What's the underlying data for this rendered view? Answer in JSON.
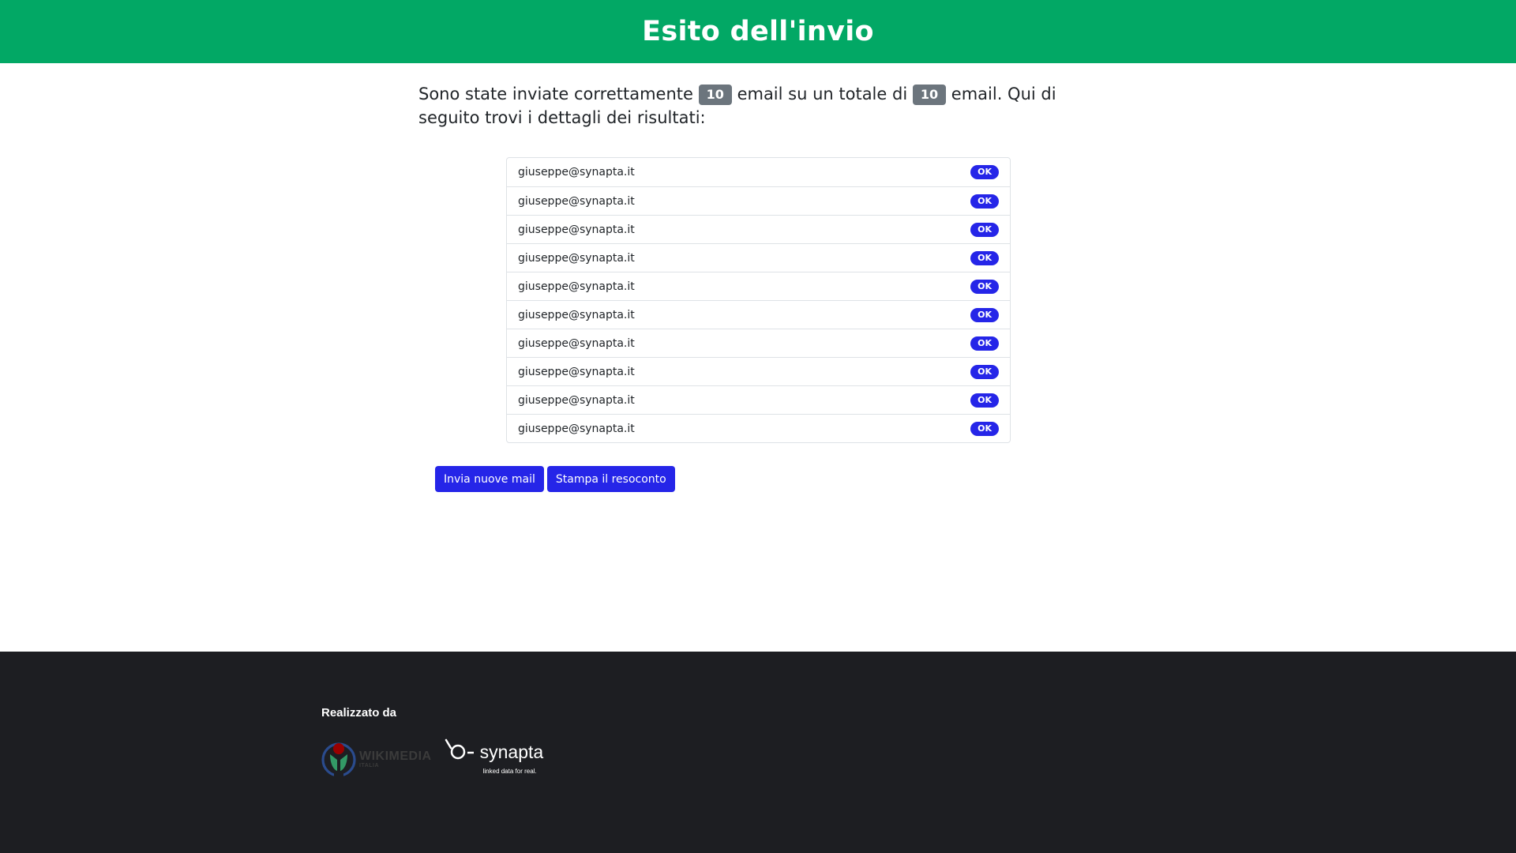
{
  "colors": {
    "header_bg": "#02a865",
    "footer_bg": "#1d1e22",
    "primary_button": "#2525e8",
    "ok_badge": "#2525e8",
    "count_badge": "#6c757d"
  },
  "header": {
    "title": "Esito dell'invio"
  },
  "summary": {
    "text_before": "Sono state inviate correttamente",
    "sent_count": "10",
    "text_middle": "email su un totale di",
    "total_count": "10",
    "text_after": "email. Qui di seguito trovi i dettagli dei risultati:"
  },
  "results": [
    {
      "email": "giuseppe@synapta.it",
      "status": "OK"
    },
    {
      "email": "giuseppe@synapta.it",
      "status": "OK"
    },
    {
      "email": "giuseppe@synapta.it",
      "status": "OK"
    },
    {
      "email": "giuseppe@synapta.it",
      "status": "OK"
    },
    {
      "email": "giuseppe@synapta.it",
      "status": "OK"
    },
    {
      "email": "giuseppe@synapta.it",
      "status": "OK"
    },
    {
      "email": "giuseppe@synapta.it",
      "status": "OK"
    },
    {
      "email": "giuseppe@synapta.it",
      "status": "OK"
    },
    {
      "email": "giuseppe@synapta.it",
      "status": "OK"
    },
    {
      "email": "giuseppe@synapta.it",
      "status": "OK"
    }
  ],
  "actions": {
    "send_new_label": "Invia nuove mail",
    "print_label": "Stampa il resoconto"
  },
  "footer": {
    "title": "Realizzato da",
    "wikimedia_logo": {
      "name": "WIKIMEDIA",
      "sub": "ITALIA",
      "icon": "wikimedia-logo"
    },
    "synapta_logo": {
      "name": "synapta",
      "tagline": "linked data for real.",
      "icon": "synapta-logo"
    }
  }
}
